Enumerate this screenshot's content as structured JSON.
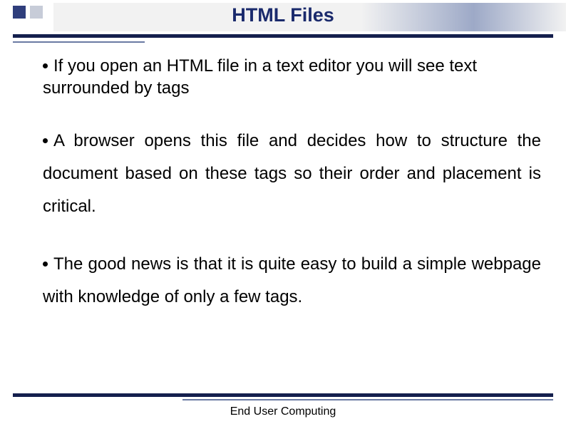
{
  "title": "HTML Files",
  "bullets": {
    "b1": "If you open an HTML file in a text editor you will see text surrounded by tags",
    "b2": "A browser opens this file and decides how to structure the document based on these tags so their order and placement is critical.",
    "b3": "The good news is that it is quite easy to build a simple webpage with knowledge of only a few tags."
  },
  "footer": "End User Computing"
}
